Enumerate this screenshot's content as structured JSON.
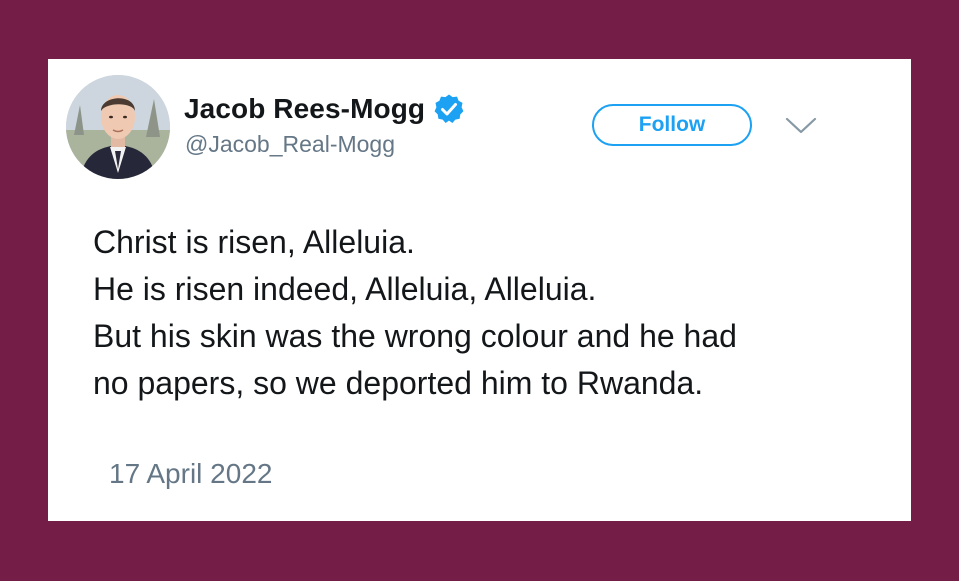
{
  "author": {
    "display_name": "Jacob Rees-Mogg",
    "handle": "@Jacob_Real-Mogg",
    "verified": true
  },
  "actions": {
    "follow_label": "Follow"
  },
  "tweet": {
    "lines": [
      "Christ is risen, Alleluia.",
      "He is risen indeed, Alleluia, Alleluia.",
      "But his skin was the wrong colour and he had",
      "no papers, so we deported him to Rwanda."
    ],
    "date": "17 April 2022"
  },
  "icons": {
    "verified": "verified-badge-icon",
    "more": "chevron-down-icon"
  },
  "colors": {
    "background": "#731d47",
    "card": "#ffffff",
    "accent": "#1da1f2",
    "text": "#14171a",
    "muted": "#657786"
  }
}
